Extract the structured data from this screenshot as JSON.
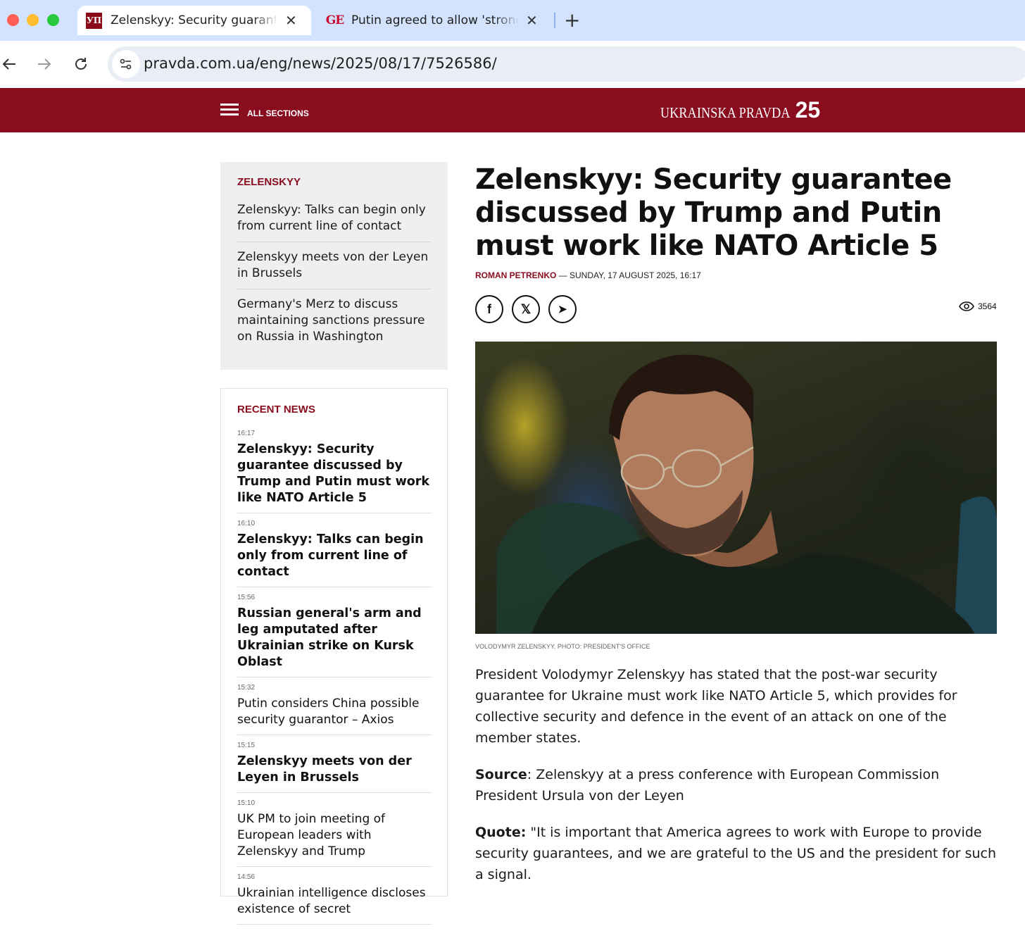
{
  "browser": {
    "tabs": [
      {
        "favicon": "УП",
        "title": "Zelenskyy: Security guarantee discussed by Trump and Putin must work like NATO Article 5",
        "active": true
      },
      {
        "favicon": "GE",
        "title": "Putin agreed to allow 'strong' security guarantees",
        "active": false
      }
    ],
    "close_glyph": "✕",
    "new_tab_glyph": "+",
    "url": "pravda.com.ua/eng/news/2025/08/17/7526586/"
  },
  "header": {
    "menu_label": "ALL SECTIONS",
    "logo_text": "UKRAINSKA PRAVDA",
    "logo_number": "25",
    "brand_color": "#8a0c1f"
  },
  "tag_box": {
    "heading": "ZELENSKYY",
    "items": [
      "Zelenskyy: Talks can begin only from current line of contact",
      "Zelenskyy meets von der Leyen in Brussels",
      "Germany's Merz to discuss maintaining sanctions pressure on Russia in Washington"
    ]
  },
  "recent": {
    "heading": "RECENT NEWS",
    "items": [
      {
        "time": "16:17",
        "title": "Zelenskyy: Security guarantee discussed by Trump and Putin must work like NATO Article 5",
        "bold": true
      },
      {
        "time": "16:10",
        "title": "Zelenskyy: Talks can begin only from current line of contact",
        "bold": true
      },
      {
        "time": "15:56",
        "title": "Russian general's arm and leg amputated after Ukrainian strike on Kursk Oblast",
        "bold": true
      },
      {
        "time": "15:32",
        "title": "Putin considers China possible security guarantor – Axios",
        "bold": false
      },
      {
        "time": "15:15",
        "title": "Zelenskyy meets von der Leyen in Brussels",
        "bold": true
      },
      {
        "time": "15:10",
        "title": "UK PM to join meeting of European leaders with Zelenskyy and Trump",
        "bold": false
      },
      {
        "time": "14:56",
        "title": "Ukrainian intelligence discloses existence of secret",
        "bold": false
      }
    ]
  },
  "article": {
    "headline": "Zelenskyy: Security guarantee discussed by Trump and Putin must work like NATO Article 5",
    "author": "ROMAN PETRENKO",
    "date": " — SUNDAY, 17 AUGUST 2025, 16:17",
    "share": [
      {
        "icon": "facebook-icon",
        "glyph": "f"
      },
      {
        "icon": "x-icon",
        "glyph": "𝕏"
      },
      {
        "icon": "telegram-icon",
        "glyph": "➤"
      }
    ],
    "views": "3564",
    "photo_caption": "VOLODYMYR ZELENSKYY. PHOTO: PRESIDENT'S OFFICE",
    "paragraph1": "President Volodymyr Zelenskyy has stated that the post-war security guarantee for Ukraine must work like NATO Article 5, which provides for collective security and defence in the event of an attack on one of the member states.",
    "source_label": "Source",
    "source_text": ": Zelenskyy at a press conference with European Commission President Ursula von der Leyen",
    "quote_label": "Quote:",
    "quote_text": " \"It is important that America agrees to work with Europe to provide security guarantees, and we are grateful to the US and the president for such a signal."
  }
}
